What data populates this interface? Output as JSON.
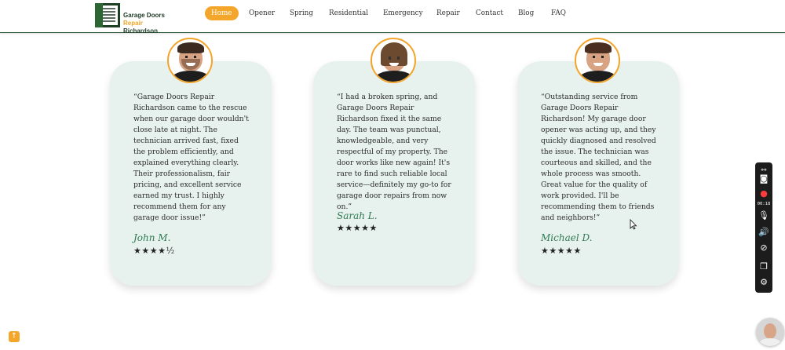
{
  "brand": {
    "line1_a": "Garage Doors",
    "line1_b": "Repair",
    "line2": "Richardson"
  },
  "nav": {
    "items": [
      "Home",
      "Opener",
      "Spring",
      "Residential",
      "Emergency",
      "Repair",
      "Contact",
      "Blog",
      "FAQ"
    ],
    "active": "Home"
  },
  "testimonials": [
    {
      "quote": "“Garage Doors Repair Richardson came to the rescue when our garage door wouldn't close late at night. The technician arrived fast, fixed the problem efficiently, and explained everything clearly. Their professionalism, fair pricing, and excellent service earned my trust. I highly recommend them for any garage door issue!”",
      "name": "John M.",
      "stars": "★★★★½",
      "rating": 4.5
    },
    {
      "quote": "“I had a broken spring, and Garage Doors Repair Richardson fixed it the same day. The team was punctual, knowledgeable, and very respectful of my property. The door works like new again! It's rare to find such reliable local service—definitely my go-to for garage door repairs from now on.”",
      "name": "Sarah L.",
      "stars": "★★★★★",
      "rating": 5
    },
    {
      "quote": "“Outstanding service from Garage Doors Repair Richardson! My garage door opener was acting up, and they quickly diagnosed and resolved the issue. The technician was courteous and skilled, and the whole process was smooth. Great value for the quality of work provided. I'll be recommending them to friends and neighbors!”",
      "name": "Michael D.",
      "stars": "★★★★★",
      "rating": 5
    }
  ],
  "recorder": {
    "timer": "00:18"
  },
  "colors": {
    "accent": "#f4a62a",
    "card_bg": "#e7f2ee",
    "name_green": "#2f7a52",
    "header_line": "#2f5d3a"
  },
  "icons": [
    "link-icon",
    "camera-icon",
    "record-icon",
    "microphone-icon",
    "speaker-icon",
    "pause-icon",
    "window-icon",
    "gear-icon",
    "arrow-up-icon"
  ]
}
